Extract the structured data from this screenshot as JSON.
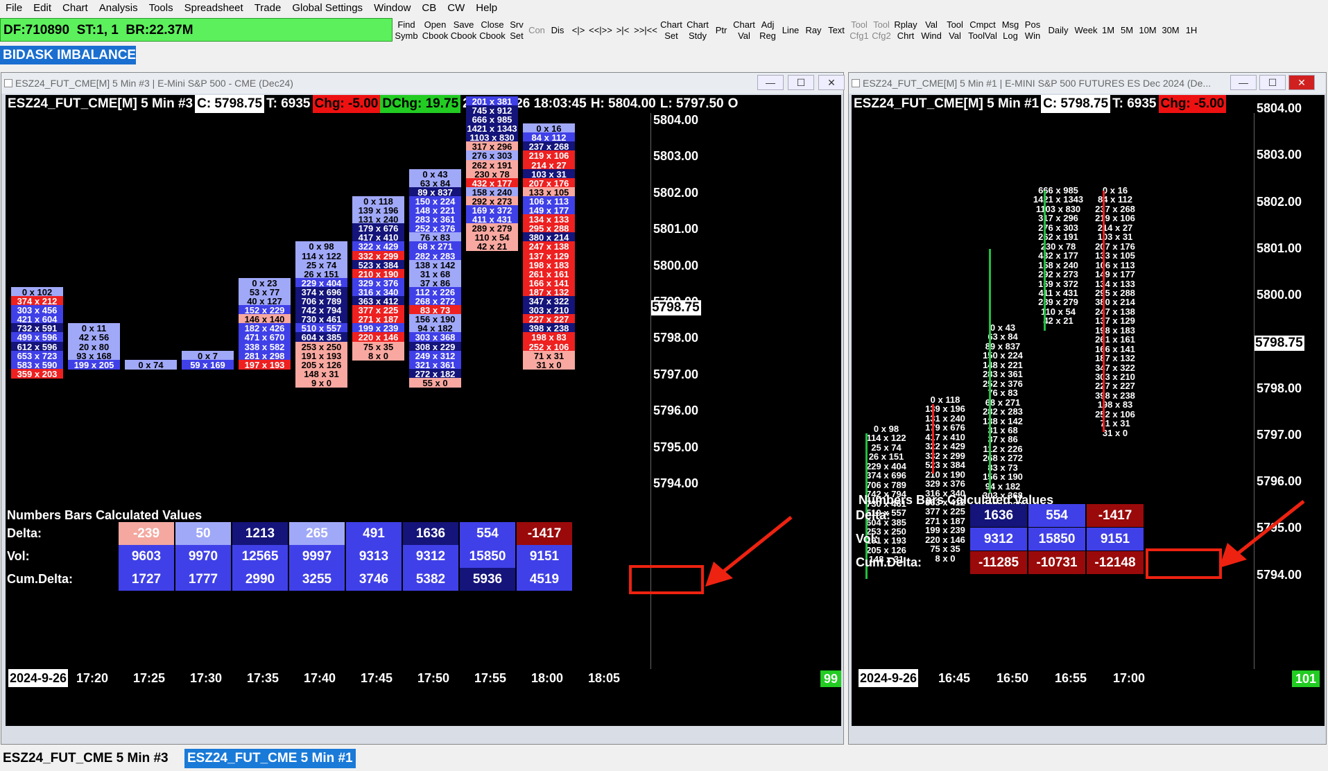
{
  "menu": [
    "File",
    "Edit",
    "Chart",
    "Analysis",
    "Tools",
    "Spreadsheet",
    "Trade",
    "Global Settings",
    "Window",
    "CB",
    "CW",
    "Help"
  ],
  "status": {
    "df": "DF:710890",
    "st": "ST:1, 1",
    "br": "BR:22.37M"
  },
  "toolbar": [
    "Find\nSymb",
    "Open\nCbook",
    "Save\nCbook",
    "Close\nCbook",
    "Srv\nSet",
    "Con",
    "Dis",
    "<|>",
    "<<|>>",
    ">|<",
    ">>|<<",
    "Chart\nSet",
    "Chart\nStdy",
    "Ptr",
    "Chart\nVal",
    "Adj\nReg",
    "Line",
    "Ray",
    "Text",
    "Tool\nCfg1",
    "Tool\nCfg2",
    "Rplay\nChrt",
    "Val\nWind",
    "Tool\nVal",
    "Cmpct\nToolVal",
    "Msg\nLog",
    "Pos\nWin",
    "Daily",
    "Week",
    "1M",
    "5M",
    "10M",
    "30M",
    "1H"
  ],
  "toolbar_disabled": [
    "Con",
    "Tool\nCfg1",
    "Tool\nCfg2"
  ],
  "bidask_label": "BIDASK IMBALANCE",
  "colors": {
    "strong_blue": "#1414a0",
    "mid_blue": "#4040e8",
    "light_blue": "#a0a8f8",
    "strong_red": "#9a0a0a",
    "mid_red": "#ee2020",
    "light_red": "#f8a8a0",
    "green_marker": "#20c040"
  },
  "left": {
    "title": "ESZ24_FUT_CME[M]  5 Min  #3 | E-Mini S&P 500 - CME (Dec24)",
    "header": {
      "symbol": "ESZ24_FUT_CME[M]  5 Min  #3",
      "close": "C: 5798.75",
      "trades": "T: 6935",
      "chg": "Chg: -5.00",
      "dchg": "DChg: 19.75",
      "datetime": "2024-09-26  18:03:45",
      "high": "H: 5804.00",
      "low": "L: 5797.50",
      "open": "O"
    },
    "price_labels": [
      "5804.00",
      "5803.00",
      "5802.00",
      "5801.00",
      "5800.00",
      "5799.00",
      "5798.00",
      "5797.00",
      "5796.00",
      "5795.00",
      "5794.00"
    ],
    "current_price": "5798.75",
    "bars": [
      {
        "top_tick": 19,
        "cells": [
          [
            "0 x 102",
            "l"
          ],
          [
            "374 x 212",
            "R"
          ],
          [
            "303 x 456",
            "B"
          ],
          [
            "421 x 604",
            "B"
          ],
          [
            "732 x 591",
            "D"
          ],
          [
            "499 x 596",
            "B"
          ],
          [
            "612 x 596",
            "D"
          ],
          [
            "653 x 723",
            "B"
          ],
          [
            "583 x 590",
            "B"
          ],
          [
            "359 x 203",
            "R"
          ]
        ]
      },
      {
        "top_tick": 23,
        "cells": [
          [
            "0 x 11",
            "l"
          ],
          [
            "42 x 56",
            "b"
          ],
          [
            "20 x 80",
            "b"
          ],
          [
            "93 x 168",
            "b"
          ],
          [
            "199 x 205",
            "B"
          ]
        ]
      },
      {
        "top_tick": 27,
        "cells": [
          [
            "0 x 74",
            "b"
          ]
        ]
      },
      {
        "top_tick": 26,
        "cells": [
          [
            "0 x 7",
            "b"
          ],
          [
            "59 x 169",
            "B"
          ]
        ]
      },
      {
        "top_tick": 18,
        "cells": [
          [
            "0 x 23",
            "l"
          ],
          [
            "53 x 77",
            "b"
          ],
          [
            "40 x 127",
            "b"
          ],
          [
            "152 x 229",
            "B"
          ],
          [
            "146 x 140",
            "r"
          ],
          [
            "182 x 426",
            "B"
          ],
          [
            "471 x 670",
            "B"
          ],
          [
            "338 x 582",
            "B"
          ],
          [
            "281 x 298",
            "B"
          ],
          [
            "197 x 193",
            "R"
          ]
        ]
      },
      {
        "top_tick": 14,
        "cells": [
          [
            "0 x 98",
            "l"
          ],
          [
            "114 x 122",
            "l"
          ],
          [
            "25 x 74",
            "b"
          ],
          [
            "26 x 151",
            "b"
          ],
          [
            "229 x 404",
            "B"
          ],
          [
            "374 x 696",
            "D"
          ],
          [
            "706 x 789",
            "D"
          ],
          [
            "742 x 794",
            "D"
          ],
          [
            "730 x 461",
            "D"
          ],
          [
            "510 x 557",
            "B"
          ],
          [
            "604 x 385",
            "D"
          ],
          [
            "253 x 250",
            "r"
          ],
          [
            "191 x 193",
            "r"
          ],
          [
            "205 x 126",
            "r"
          ],
          [
            "148 x 31",
            "r"
          ],
          [
            "9 x 0",
            "r"
          ]
        ]
      },
      {
        "top_tick": 9,
        "cells": [
          [
            "0 x 118",
            "l"
          ],
          [
            "139 x 196",
            "b"
          ],
          [
            "131 x 240",
            "b"
          ],
          [
            "179 x 676",
            "D"
          ],
          [
            "417 x 410",
            "D"
          ],
          [
            "322 x 429",
            "B"
          ],
          [
            "332 x 299",
            "R"
          ],
          [
            "523 x 384",
            "D"
          ],
          [
            "210 x 190",
            "R"
          ],
          [
            "329 x 376",
            "B"
          ],
          [
            "316 x 340",
            "B"
          ],
          [
            "363 x 412",
            "D"
          ],
          [
            "377 x 225",
            "R"
          ],
          [
            "271 x 187",
            "R"
          ],
          [
            "199 x 239",
            "B"
          ],
          [
            "220 x 146",
            "R"
          ],
          [
            "75 x 35",
            "r"
          ],
          [
            "8 x 0",
            "r"
          ]
        ]
      },
      {
        "top_tick": 6,
        "cells": [
          [
            "0 x 43",
            "l"
          ],
          [
            "63 x 84",
            "b"
          ],
          [
            "89 x 837",
            "D"
          ],
          [
            "150 x 224",
            "B"
          ],
          [
            "148 x 221",
            "B"
          ],
          [
            "283 x 361",
            "B"
          ],
          [
            "252 x 376",
            "B"
          ],
          [
            "76 x 83",
            "b"
          ],
          [
            "68 x 271",
            "B"
          ],
          [
            "282 x 283",
            "B"
          ],
          [
            "138 x 142",
            "l"
          ],
          [
            "31 x 68",
            "b"
          ],
          [
            "37 x 86",
            "b"
          ],
          [
            "112 x 226",
            "B"
          ],
          [
            "268 x 272",
            "B"
          ],
          [
            "83 x 73",
            "R"
          ],
          [
            "156 x 190",
            "l"
          ],
          [
            "94 x 182",
            "l"
          ],
          [
            "303 x 368",
            "B"
          ],
          [
            "308 x 229",
            "D"
          ],
          [
            "249 x 312",
            "B"
          ],
          [
            "321 x 361",
            "B"
          ],
          [
            "272 x 182",
            "D"
          ],
          [
            "55 x 0",
            "r"
          ]
        ]
      },
      {
        "top_tick": -2,
        "cells": [
          [
            "201 x 381",
            "B"
          ],
          [
            "745 x 912",
            "D"
          ],
          [
            "666 x 985",
            "D"
          ],
          [
            "1421 x 1343",
            "D"
          ],
          [
            "1103 x 830",
            "D"
          ],
          [
            "317 x 296",
            "r"
          ],
          [
            "276 x 303",
            "b"
          ],
          [
            "262 x 191",
            "r"
          ],
          [
            "230 x 78",
            "r"
          ],
          [
            "432 x 177",
            "R"
          ],
          [
            "158 x 240",
            "b"
          ],
          [
            "292 x 273",
            "r"
          ],
          [
            "169 x 372",
            "B"
          ],
          [
            "411 x 431",
            "B"
          ],
          [
            "289 x 279",
            "r"
          ],
          [
            "110 x 54",
            "r"
          ],
          [
            "42 x 21",
            "r"
          ]
        ]
      },
      {
        "top_tick": 1,
        "cells": [
          [
            "0 x 16",
            "l"
          ],
          [
            "84 x 112",
            "B"
          ],
          [
            "237 x 268",
            "D"
          ],
          [
            "219 x 106",
            "R"
          ],
          [
            "214 x 27",
            "R"
          ],
          [
            "103 x 31",
            "D"
          ],
          [
            "207 x 176",
            "R"
          ],
          [
            "133 x 105",
            "r"
          ],
          [
            "106 x 113",
            "B"
          ],
          [
            "149 x 177",
            "B"
          ],
          [
            "134 x 133",
            "R"
          ],
          [
            "295 x 288",
            "R"
          ],
          [
            "380 x 214",
            "D"
          ],
          [
            "247 x 138",
            "R"
          ],
          [
            "137 x 129",
            "R"
          ],
          [
            "198 x 183",
            "R"
          ],
          [
            "261 x 161",
            "R"
          ],
          [
            "166 x 141",
            "R"
          ],
          [
            "187 x 132",
            "R"
          ],
          [
            "347 x 322",
            "D"
          ],
          [
            "303 x 210",
            "D"
          ],
          [
            "227 x 227",
            "R"
          ],
          [
            "398 x 238",
            "D"
          ],
          [
            "198 x 83",
            "R"
          ],
          [
            "252 x 106",
            "R"
          ],
          [
            "71 x 31",
            "r"
          ],
          [
            "31 x 0",
            "r"
          ]
        ]
      }
    ],
    "study": {
      "title": "Numbers Bars Calculated Values",
      "rows": [
        {
          "label": "Delta:",
          "values": [
            "-239",
            "50",
            "1213",
            "265",
            "491",
            "1636",
            "554",
            "-1417"
          ],
          "colors": [
            "#f4a8a0",
            "#a0a8f8",
            "#14147a",
            "#a0a8f8",
            "#4040e8",
            "#14147a",
            "#4040e8",
            "#9a0a0a"
          ]
        },
        {
          "label": "Vol:",
          "values": [
            "9603",
            "9970",
            "12565",
            "9997",
            "9313",
            "9312",
            "15850",
            "9151"
          ],
          "colors": [
            "#4040e8",
            "#4040e8",
            "#4040e8",
            "#4040e8",
            "#4040e8",
            "#4040e8",
            "#4040e8",
            "#4040e8"
          ]
        },
        {
          "label": "Cum.Delta:",
          "values": [
            "1727",
            "1777",
            "2990",
            "3255",
            "3746",
            "5382",
            "5936",
            "4519"
          ],
          "colors": [
            "#4040e8",
            "#4040e8",
            "#4040e8",
            "#4040e8",
            "#4040e8",
            "#4040e8",
            "#14147a",
            "#4040e8"
          ]
        }
      ]
    },
    "xaxis": {
      "date": "2024-9-26",
      "times": [
        "17:20",
        "17:25",
        "17:30",
        "17:35",
        "17:40",
        "17:45",
        "17:50",
        "17:55",
        "18:00",
        "18:05"
      ]
    },
    "badge": "99"
  },
  "right": {
    "title": "ESZ24_FUT_CME[M]  5 Min  #1 | E-MINI S&P 500 FUTURES ES Dec 2024 (De...",
    "header": {
      "symbol": "ESZ24_FUT_CME[M]  5 Min  #1",
      "close": "C: 5798.75",
      "trades": "T: 6935",
      "chg": "Chg: -5.00"
    },
    "price_labels": [
      "5804.00",
      "5803.00",
      "5802.00",
      "5801.00",
      "5800.00",
      "5799.00",
      "5798.00",
      "5797.00",
      "5796.00",
      "5795.00",
      "5794.00"
    ],
    "current_price": "5798.75",
    "columns": [
      {
        "top_tick": 14,
        "cells": [
          "0 x 98",
          "114 x 122",
          "25 x 74",
          "26 x 151",
          "229 x 404",
          "374 x 696",
          "706 x 789",
          "742 x 794",
          "730 x 461",
          "510 x 557",
          "604 x 385",
          "253 x 250",
          "191 x 193",
          "205 x 126",
          "148 x 31"
        ]
      },
      {
        "top_tick": 9,
        "cells": [
          "0 x 118",
          "139 x 196",
          "131 x 240",
          "179 x 676",
          "417 x 410",
          "322 x 429",
          "332 x 299",
          "523 x 384",
          "210 x 190",
          "329 x 376",
          "316 x 340",
          "363 x 412",
          "377 x 225",
          "271 x 187",
          "199 x 239",
          "220 x 146",
          "75 x 35",
          "8 x 0"
        ]
      },
      {
        "top_tick": 6,
        "cells": [
          "0 x 43",
          "63 x 84",
          "89 x 837",
          "150 x 224",
          "148 x 221",
          "283 x 361",
          "252 x 376",
          "76 x 83",
          "68 x 271",
          "282 x 283",
          "138 x 142",
          "31 x 68",
          "37 x 86",
          "112 x 226",
          "268 x 272",
          "83 x 73",
          "156 x 190",
          "94 x 182",
          "303 x 368",
          "308 x 229",
          "249 x 312",
          "321 x 361",
          "272 x 182",
          "55 x 0"
        ]
      },
      {
        "top_tick": 0,
        "cells": [
          "666 x 985",
          "1421 x 1343",
          "1103 x 830",
          "317 x 296",
          "276 x 303",
          "262 x 191",
          "230 x 78",
          "432 x 177",
          "158 x 240",
          "292 x 273",
          "169 x 372",
          "411 x 431",
          "289 x 279",
          "110 x 54",
          "42 x 21"
        ]
      },
      {
        "top_tick": 0,
        "cells": [
          "0 x 16",
          "84 x 112",
          "237 x 268",
          "219 x 106",
          "214 x 27",
          "103 x 31",
          "207 x 176",
          "133 x 105",
          "106 x 113",
          "149 x 177",
          "134 x 133",
          "295 x 288",
          "380 x 214",
          "247 x 138",
          "137 x 129",
          "198 x 183",
          "261 x 161",
          "166 x 141",
          "187 x 132",
          "347 x 322",
          "303 x 210",
          "227 x 227",
          "398 x 238",
          "198 x 83",
          "252 x 106",
          "71 x 31",
          "31 x 0"
        ]
      }
    ],
    "study": {
      "title": "Numbers Bars Calculated Values",
      "rows": [
        {
          "label": "Delta:",
          "values": [
            "1636",
            "554",
            "-1417"
          ],
          "colors": [
            "#14147a",
            "#4040e8",
            "#9a0a0a"
          ]
        },
        {
          "label": "Vol:",
          "values": [
            "9312",
            "15850",
            "9151"
          ],
          "colors": [
            "#4040e8",
            "#4040e8",
            "#4040e8"
          ]
        },
        {
          "label": "Cum.Delta:",
          "values": [
            "-11285",
            "-10731",
            "-12148"
          ],
          "colors": [
            "#9a0a0a",
            "#9a0a0a",
            "#9a0a0a"
          ]
        }
      ]
    },
    "xaxis": {
      "date": "2024-9-26",
      "times": [
        "16:45",
        "16:50",
        "16:55",
        "17:00"
      ]
    },
    "badge": "101"
  },
  "bottom_tabs": [
    "ESZ24_FUT_CME  5 Min  #3",
    "ESZ24_FUT_CME  5 Min  #1"
  ]
}
